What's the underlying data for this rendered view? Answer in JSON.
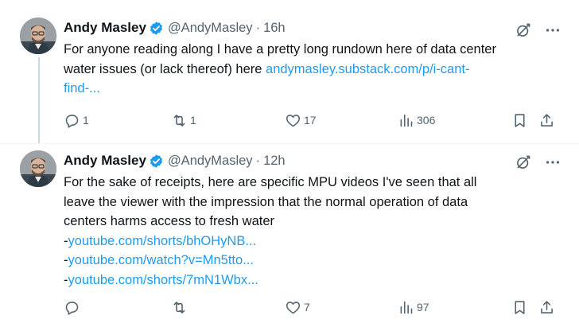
{
  "tweets": [
    {
      "author": "Andy Masley",
      "handle": "@AndyMasley",
      "separator": "·",
      "time": "16h",
      "text_lines": [
        {
          "text": "For anyone reading along I have a pretty long rundown here of data center"
        },
        {
          "text": "water issues (or lack thereof) here ",
          "link": "andymasley.substack.com/p/i-cant-"
        },
        {
          "link": "find-..."
        }
      ],
      "actions": {
        "replies": "1",
        "retweets": "1",
        "likes": "17",
        "views": "306"
      }
    },
    {
      "author": "Andy Masley",
      "handle": "@AndyMasley",
      "separator": "·",
      "time": "12h",
      "text_lines": [
        {
          "text": "For the sake of receipts, here are specific MPU videos I've seen that all"
        },
        {
          "text": "leave the viewer with the impression that the normal operation of data"
        },
        {
          "text": "centers harms access to fresh water"
        },
        {
          "prefix": "-",
          "link": "youtube.com/shorts/bhOHyNB..."
        },
        {
          "prefix": "-",
          "link": "youtube.com/watch?v=Mn5tto..."
        },
        {
          "prefix": "-",
          "link": "youtube.com/shorts/7mN1Wbx..."
        }
      ],
      "actions": {
        "replies": "",
        "retweets": "",
        "likes": "7",
        "views": "97"
      }
    }
  ],
  "icons": {
    "verified": "verified-badge-icon",
    "grok": "grok-icon",
    "more": "more-icon",
    "reply": "reply-icon",
    "retweet": "retweet-icon",
    "like": "heart-icon",
    "views": "views-chart-icon",
    "bookmark": "bookmark-icon",
    "share": "share-icon"
  },
  "colors": {
    "link": "#1d9bf0",
    "verified": "#1d9bf0",
    "secondary_text": "#536471",
    "thread_line": "#cfd9de"
  }
}
